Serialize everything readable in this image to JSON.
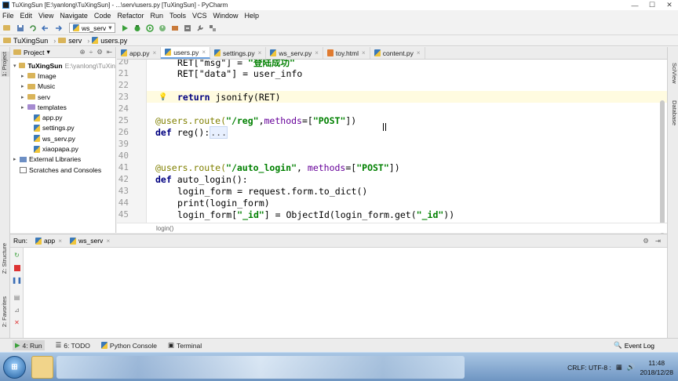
{
  "window": {
    "title": "TuXingSun [E:\\yanlong\\TuXingSun] - ...\\serv\\users.py [TuXingSun] - PyCharm",
    "controls": [
      "—",
      "☐",
      "✕"
    ]
  },
  "menu": [
    "File",
    "Edit",
    "View",
    "Navigate",
    "Code",
    "Refactor",
    "Run",
    "Tools",
    "VCS",
    "Window",
    "Help"
  ],
  "toolbar": {
    "run_config": "ws_serv"
  },
  "breadcrumb": [
    "TuXingSun",
    "serv",
    "users.py"
  ],
  "project_panel": {
    "title": "Project",
    "tree": [
      {
        "label": "TuXingSun",
        "extra": "E:\\yanlong\\TuXin",
        "type": "folder"
      },
      {
        "label": "Image",
        "type": "folder"
      },
      {
        "label": "Music",
        "type": "folder"
      },
      {
        "label": "serv",
        "type": "folder"
      },
      {
        "label": "templates",
        "type": "folder"
      },
      {
        "label": "app.py",
        "type": "py"
      },
      {
        "label": "settings.py",
        "type": "py"
      },
      {
        "label": "ws_serv.py",
        "type": "py"
      },
      {
        "label": "xiaopapa.py",
        "type": "py"
      },
      {
        "label": "External Libraries",
        "type": "lib"
      },
      {
        "label": "Scratches and Consoles",
        "type": "scratch"
      }
    ]
  },
  "left_strip": {
    "project_tab": "1: Project",
    "structure_tab": "Z: Structure",
    "favorites_tab": "2: Favorites"
  },
  "right_strip": {
    "sciview_tab": "SciView",
    "database_tab": "Database"
  },
  "editor_tabs": [
    {
      "label": "app.py",
      "type": "py",
      "active": false
    },
    {
      "label": "users.py",
      "type": "py",
      "active": true
    },
    {
      "label": "settings.py",
      "type": "py",
      "active": false
    },
    {
      "label": "ws_serv.py",
      "type": "py",
      "active": false
    },
    {
      "label": "toy.html",
      "type": "html",
      "active": false
    },
    {
      "label": "content.py",
      "type": "py",
      "active": false
    }
  ],
  "editor": {
    "line_numbers": [
      "20",
      "21",
      "22",
      "23",
      "24",
      "25",
      "26",
      "39",
      "40",
      "41",
      "42",
      "43",
      "44",
      "45",
      "46"
    ],
    "lines": {
      "l20a": "RET[\"msg\"] = ",
      "l20b": "\"登陆成功\"",
      "l21": "RET[\"data\"] = user_info",
      "l23kw": "return",
      "l23": " jsonify(RET)",
      "l25deco": "@users.route(",
      "l25str": "\"/reg\"",
      "l25mid": ",",
      "l25kwarg": "methods",
      "l25end": "=[",
      "l25str2": "\"POST\"",
      "l25close": "])",
      "l26kw": "def",
      "l26": " reg():",
      "l26fold": "...",
      "l41deco": "@users.route(",
      "l41str": "\"/auto_login\"",
      "l41mid": ", ",
      "l41kwarg": "methods",
      "l41end": "=[",
      "l41str2": "\"POST\"",
      "l41close": "])",
      "l42kw": "def",
      "l42": " auto_login():",
      "l43": "login_form = request.form.to_dict()",
      "l44": "print(login_form)",
      "l45a": "login_form[",
      "l45str": "\"_id\"",
      "l45b": "] = ObjectId(login_form.get(",
      "l45str2": "\"_id\"",
      "l45c": "))"
    },
    "status": "login()"
  },
  "run_panel": {
    "label": "Run:",
    "tabs": [
      "app",
      "ws_serv"
    ]
  },
  "bottom_tabs": [
    {
      "label": "4: Run",
      "active": true
    },
    {
      "label": "6: TODO",
      "active": false
    },
    {
      "label": "Python Console",
      "active": false
    },
    {
      "label": "Terminal",
      "active": false
    }
  ],
  "event_log": "Event Log",
  "taskbar": {
    "tray_text": "CRLF:  UTF-8 :",
    "time": "11:48",
    "date": "2018/12/28"
  }
}
